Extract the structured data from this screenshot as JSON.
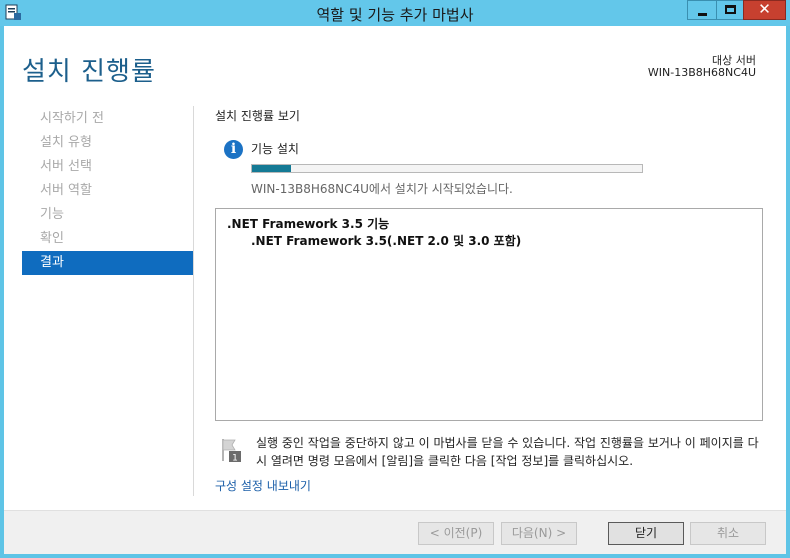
{
  "window": {
    "title": "역할 및 기능 추가 마법사",
    "close_glyph": "✕"
  },
  "header": {
    "page_title": "설치 진행률",
    "target_label": "대상 서버",
    "target_server": "WIN-13B8H68NC4U"
  },
  "sidebar": {
    "items": [
      {
        "label": "시작하기 전",
        "active": false
      },
      {
        "label": "설치 유형",
        "active": false
      },
      {
        "label": "서버 선택",
        "active": false
      },
      {
        "label": "서버 역할",
        "active": false
      },
      {
        "label": "기능",
        "active": false
      },
      {
        "label": "확인",
        "active": false
      },
      {
        "label": "결과",
        "active": true
      }
    ]
  },
  "main": {
    "section_title": "설치 진행률 보기",
    "info_glyph": "i",
    "feature_status_label": "기능 설치",
    "progress_fraction": 0.1,
    "status_text": "WIN-13B8H68NC4U에서 설치가 시작되었습니다.",
    "results": [
      ".NET Framework 3.5 기능",
      ".NET Framework 3.5(.NET 2.0 및 3.0 포함)"
    ],
    "note": "실행 중인 작업을 중단하지 않고 이 마법사를 닫을 수 있습니다. 작업 진행률을 보거나 이 페이지를 다시 열려면 명령 모음에서 [알림]을 클릭한 다음 [작업 정보]를 클릭하십시오.",
    "note_badge": "1",
    "export_link": "구성 설정 내보내기"
  },
  "footer": {
    "prev_label": "< 이전(P)",
    "next_label": "다음(N) >",
    "close_label": "닫기",
    "cancel_label": "취소"
  },
  "colors": {
    "titlebar": "#63c7ea",
    "accent": "#0f6cbf",
    "progress": "#157a95",
    "link": "#1a5ea8"
  }
}
